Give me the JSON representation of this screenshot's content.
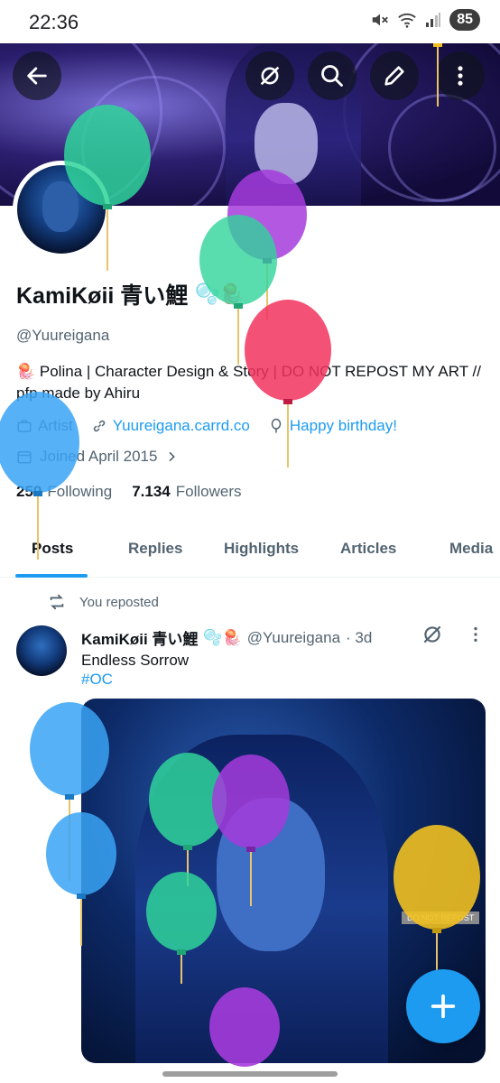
{
  "status_bar": {
    "time": "22:36",
    "battery": "85"
  },
  "header": {
    "back_icon": "arrow-left-icon",
    "actions": [
      "mute-icon",
      "search-icon",
      "edit-icon",
      "more-vertical-icon"
    ]
  },
  "profile": {
    "display_name": "KamiKøii 青い鯉",
    "name_emojis": "🫧🪼",
    "handle": "@Yuureigana",
    "bio": "🪼 Polina | Character Design & Story | DO NOT REPOST MY ART // pfp made by Ahiru",
    "category": "Artist",
    "website": "Yuureigana.carrd.co",
    "birthday": "Happy birthday!",
    "joined": "Joined April 2015",
    "following_count": "259",
    "following_label": "Following",
    "followers_count": "7.134",
    "followers_label": "Followers"
  },
  "tabs": [
    "Posts",
    "Replies",
    "Highlights",
    "Articles",
    "Media"
  ],
  "post": {
    "repost_label": "You reposted",
    "author_name": "KamiKøii 青い鯉",
    "author_emojis": "🫧🪼",
    "author_handle": "@Yuureigana",
    "time": "· 3d",
    "text": "Endless Sorrow",
    "hashtag": "#OC",
    "image_watermark": "DO NOT REPOST"
  },
  "fab": {
    "label": "+"
  },
  "colors": {
    "accent": "#1d9bf0",
    "text": "#0f1419",
    "muted": "#536471"
  }
}
